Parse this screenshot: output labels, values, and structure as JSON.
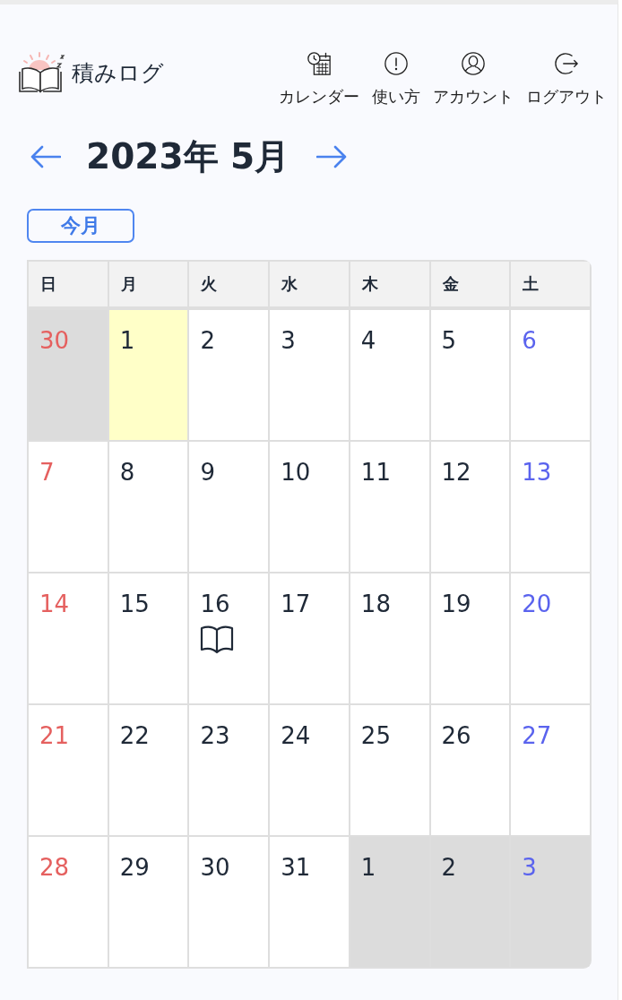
{
  "header": {
    "app_name": "積みログ",
    "nav": [
      {
        "label": "カレンダー",
        "kind": "calendar"
      },
      {
        "label": "使い方",
        "kind": "help"
      },
      {
        "label": "アカウント",
        "kind": "account"
      },
      {
        "label": "ログアウト",
        "kind": "logout"
      }
    ]
  },
  "month_nav": {
    "title": "2023年 5月",
    "today_button": "今月"
  },
  "calendar": {
    "weekdays": [
      "日",
      "月",
      "火",
      "水",
      "木",
      "金",
      "土"
    ],
    "weeks": [
      [
        {
          "day": "30",
          "in_month": false,
          "today": false,
          "has_log": false
        },
        {
          "day": "1",
          "in_month": true,
          "today": true,
          "has_log": false
        },
        {
          "day": "2",
          "in_month": true,
          "today": false,
          "has_log": false
        },
        {
          "day": "3",
          "in_month": true,
          "today": false,
          "has_log": false
        },
        {
          "day": "4",
          "in_month": true,
          "today": false,
          "has_log": false
        },
        {
          "day": "5",
          "in_month": true,
          "today": false,
          "has_log": false
        },
        {
          "day": "6",
          "in_month": true,
          "today": false,
          "has_log": false
        }
      ],
      [
        {
          "day": "7",
          "in_month": true,
          "today": false,
          "has_log": false
        },
        {
          "day": "8",
          "in_month": true,
          "today": false,
          "has_log": false
        },
        {
          "day": "9",
          "in_month": true,
          "today": false,
          "has_log": false
        },
        {
          "day": "10",
          "in_month": true,
          "today": false,
          "has_log": false
        },
        {
          "day": "11",
          "in_month": true,
          "today": false,
          "has_log": false
        },
        {
          "day": "12",
          "in_month": true,
          "today": false,
          "has_log": false
        },
        {
          "day": "13",
          "in_month": true,
          "today": false,
          "has_log": false
        }
      ],
      [
        {
          "day": "14",
          "in_month": true,
          "today": false,
          "has_log": false
        },
        {
          "day": "15",
          "in_month": true,
          "today": false,
          "has_log": false
        },
        {
          "day": "16",
          "in_month": true,
          "today": false,
          "has_log": true
        },
        {
          "day": "17",
          "in_month": true,
          "today": false,
          "has_log": false
        },
        {
          "day": "18",
          "in_month": true,
          "today": false,
          "has_log": false
        },
        {
          "day": "19",
          "in_month": true,
          "today": false,
          "has_log": false
        },
        {
          "day": "20",
          "in_month": true,
          "today": false,
          "has_log": false
        }
      ],
      [
        {
          "day": "21",
          "in_month": true,
          "today": false,
          "has_log": false
        },
        {
          "day": "22",
          "in_month": true,
          "today": false,
          "has_log": false
        },
        {
          "day": "23",
          "in_month": true,
          "today": false,
          "has_log": false
        },
        {
          "day": "24",
          "in_month": true,
          "today": false,
          "has_log": false
        },
        {
          "day": "25",
          "in_month": true,
          "today": false,
          "has_log": false
        },
        {
          "day": "26",
          "in_month": true,
          "today": false,
          "has_log": false
        },
        {
          "day": "27",
          "in_month": true,
          "today": false,
          "has_log": false
        }
      ],
      [
        {
          "day": "28",
          "in_month": true,
          "today": false,
          "has_log": false
        },
        {
          "day": "29",
          "in_month": true,
          "today": false,
          "has_log": false
        },
        {
          "day": "30",
          "in_month": true,
          "today": false,
          "has_log": false
        },
        {
          "day": "31",
          "in_month": true,
          "today": false,
          "has_log": false
        },
        {
          "day": "1",
          "in_month": false,
          "today": false,
          "has_log": false
        },
        {
          "day": "2",
          "in_month": false,
          "today": false,
          "has_log": false
        },
        {
          "day": "3",
          "in_month": false,
          "today": false,
          "has_log": false
        }
      ]
    ]
  }
}
